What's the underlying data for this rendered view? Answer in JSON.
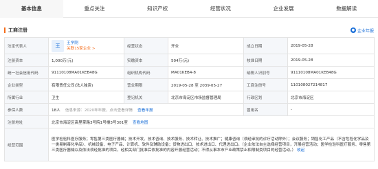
{
  "tabs": [
    "基本信息",
    "重点关注",
    "知识产权",
    "经营状况",
    "企业发展",
    "数据解读"
  ],
  "section": {
    "title": "工商注册",
    "right_label": "企业年报"
  },
  "rows": {
    "legal_rep_key": "法定代表人",
    "legal_rep_avatar": "王",
    "legal_rep_name": "王学刚",
    "legal_rep_sub": "关联15家企业 >",
    "status_key": "经营状态",
    "status_val": "开业",
    "founded_key": "成立日期",
    "founded_val": "2019-05-28",
    "capital_key": "注册资本",
    "capital_val": "1,000万(元)",
    "paidin_key": "实缴资本",
    "paidin_val": "504万(元)",
    "approved_key": "核准日期",
    "approved_val": "2019-05-28",
    "credit_key": "统一社会信用代码",
    "credit_val": "91110108MA01KEB48G",
    "org_key": "组织机构代码",
    "org_val": "MA01KEB4-8",
    "tax_key": "纳税人识别号",
    "tax_val": "91110108MA01KEB48G",
    "type_key": "企业类型",
    "type_val": "有限责任公司(法人独资)",
    "term_key": "营业期限",
    "term_val": "2019-05-28 至 2039-05-27",
    "reg_no_key": "工商注册号",
    "reg_no_val": "110108027214817",
    "industry_key": "所属行业",
    "industry_val": "卫生",
    "authority_key": "登记机关",
    "authority_val": "北京市海淀区市场监督管理局",
    "region_key": "行政区划",
    "region_val": "北京市海淀区",
    "insured_key": "参保人数",
    "insured_val": "18人",
    "insured_note": "信息来源：2020年年报，点击查看详情",
    "insured_link": "查看年报",
    "former_key": "曾用名",
    "former_val": "-",
    "address_key": "注册地址",
    "address_val": "北京市海淀区高里掌路3号院1号楼3号301室",
    "address_link": "查看地图",
    "scope_key": "经营范围",
    "scope_val": "医学检验科医疗服务；零售第三类医疗器械；技术开发、技术咨询、技术服务、技术转让、技术推广；健康咨询（须经审批的诊疗活动除外）；会议服务；销售化工产品（不含危险化学品及一类易制毒化学品）、机械设备、电子产品、计算机、软件及辅助设备；货物进出口、技术进出口、代理进出口。（企业依法自主选择经营项目，开展经营活动；医学检验科医疗服务、零售第三类医疗器械以及依法须经批准的项目，经相关部门批准后依批准的内容开展经营活动；不得从事本市产业政策禁止和限制类项目的经营活动。）",
    "scope_link": "收起"
  }
}
